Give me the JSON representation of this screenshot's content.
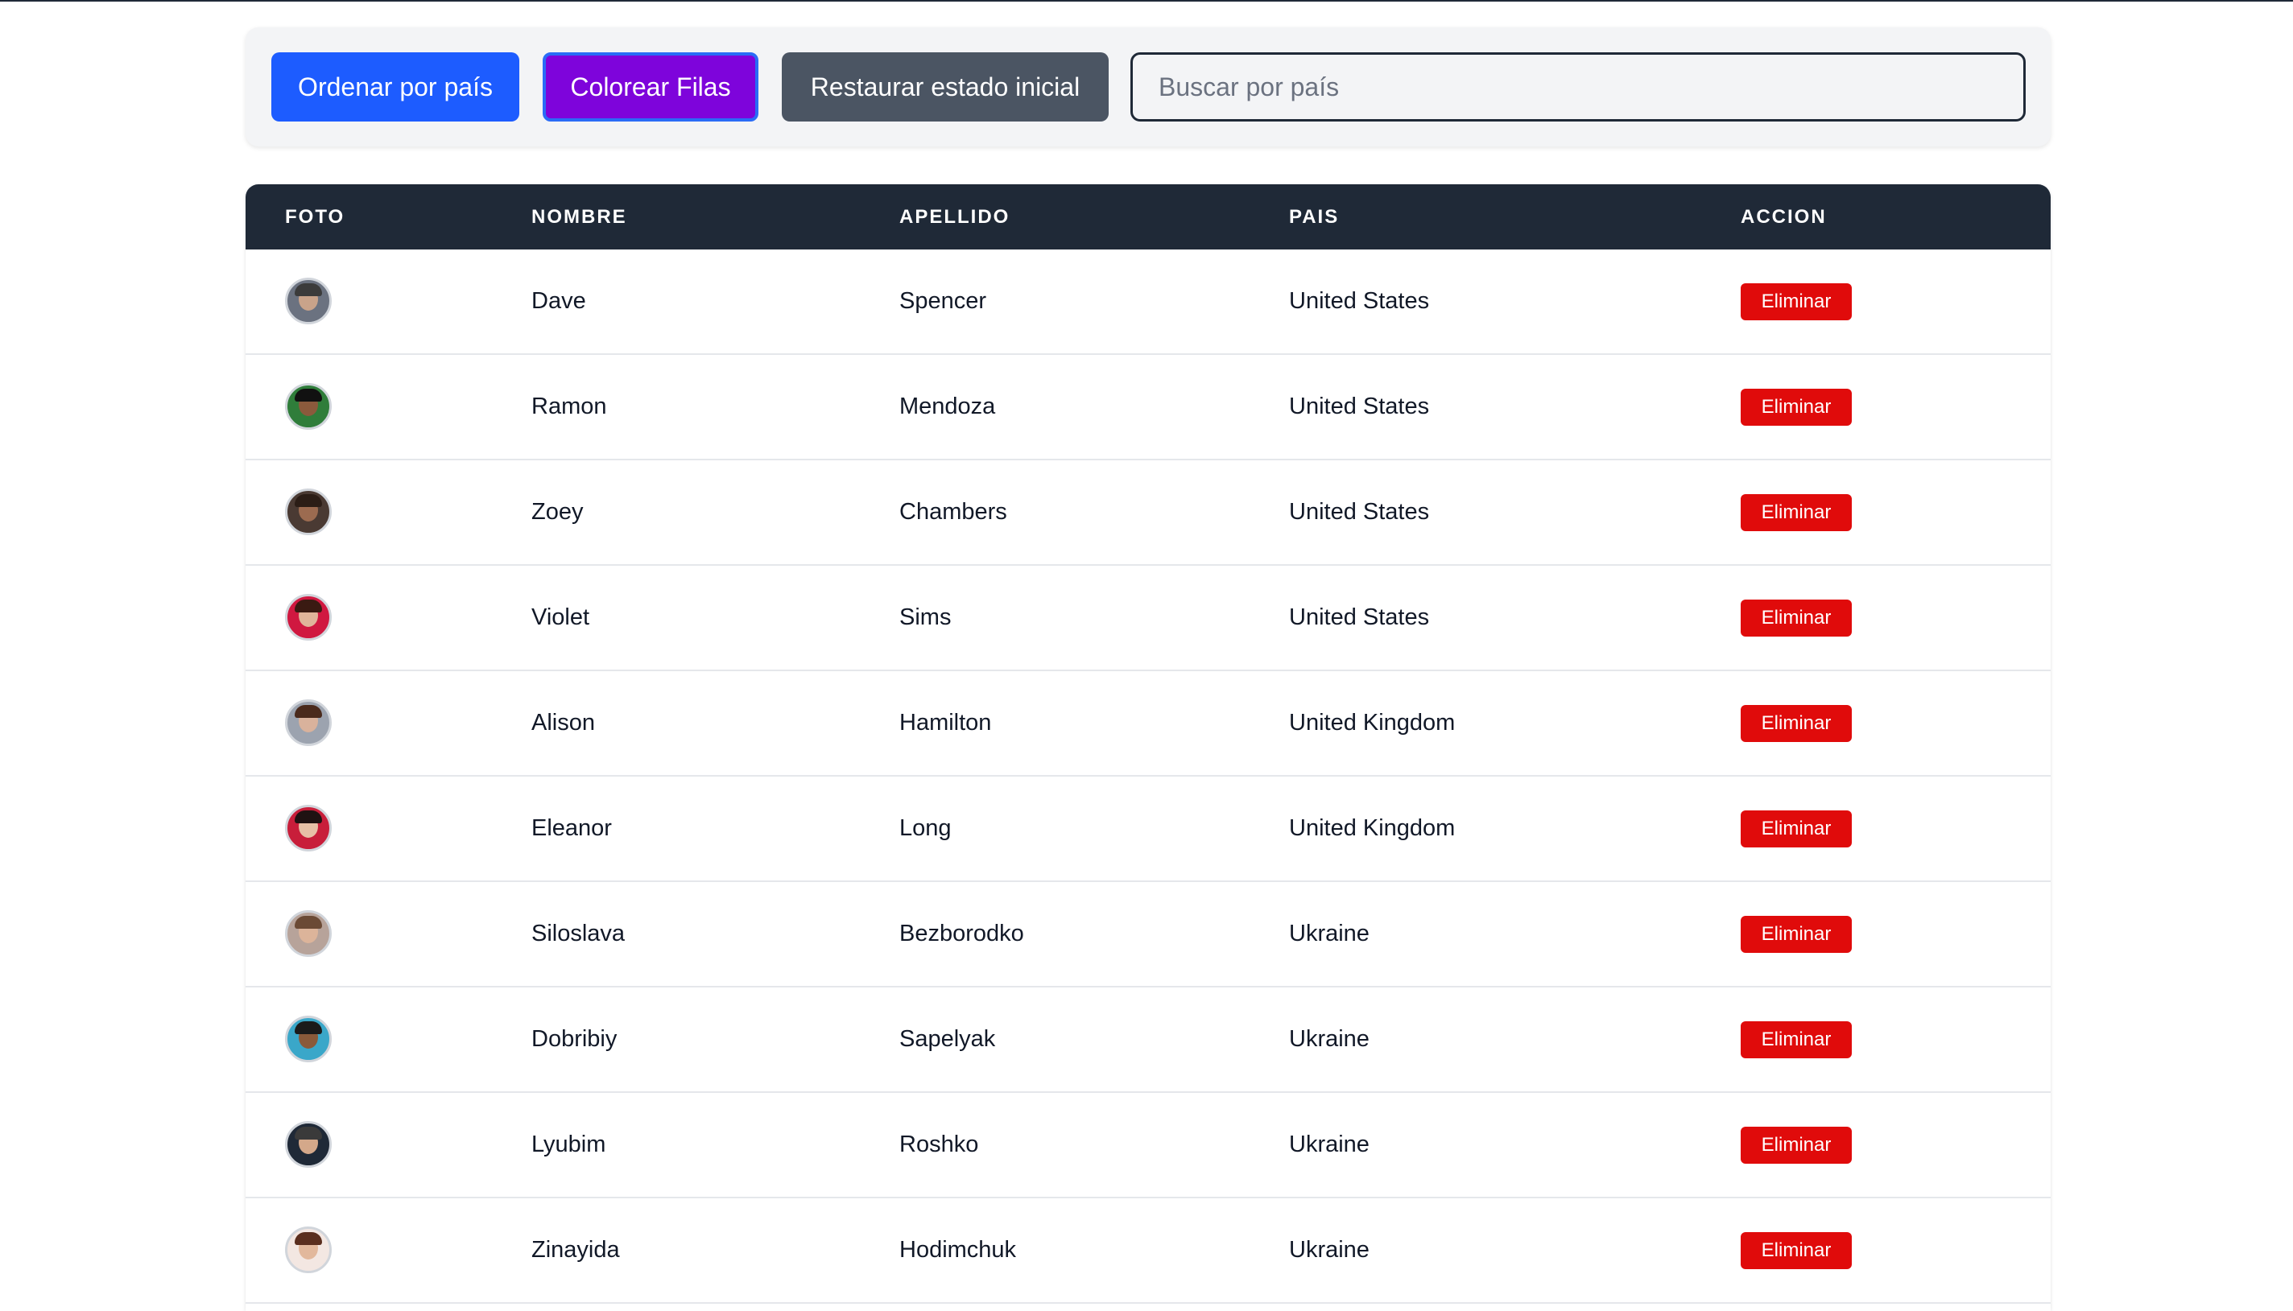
{
  "toolbar": {
    "sort_label": "Ordenar por país",
    "color_label": "Colorear Filas",
    "reset_label": "Restaurar estado inicial",
    "search_placeholder": "Buscar por país",
    "search_value": ""
  },
  "table": {
    "headers": [
      "FOTO",
      "NOMBRE",
      "APELLIDO",
      "PAIS",
      "ACCION"
    ],
    "delete_label": "Eliminar",
    "rows": [
      {
        "nombre": "Dave",
        "apellido": "Spencer",
        "pais": "United States",
        "avatar": "avatar-photo"
      },
      {
        "nombre": "Ramon",
        "apellido": "Mendoza",
        "pais": "United States",
        "avatar": "avatar-photo"
      },
      {
        "nombre": "Zoey",
        "apellido": "Chambers",
        "pais": "United States",
        "avatar": "avatar-photo"
      },
      {
        "nombre": "Violet",
        "apellido": "Sims",
        "pais": "United States",
        "avatar": "avatar-photo"
      },
      {
        "nombre": "Alison",
        "apellido": "Hamilton",
        "pais": "United Kingdom",
        "avatar": "avatar-photo"
      },
      {
        "nombre": "Eleanor",
        "apellido": "Long",
        "pais": "United Kingdom",
        "avatar": "avatar-photo"
      },
      {
        "nombre": "Siloslava",
        "apellido": "Bezborodko",
        "pais": "Ukraine",
        "avatar": "avatar-photo"
      },
      {
        "nombre": "Dobribiy",
        "apellido": "Sapelyak",
        "pais": "Ukraine",
        "avatar": "avatar-photo"
      },
      {
        "nombre": "Lyubim",
        "apellido": "Roshko",
        "pais": "Ukraine",
        "avatar": "avatar-photo"
      },
      {
        "nombre": "Zinayida",
        "apellido": "Hodimchuk",
        "pais": "Ukraine",
        "avatar": "avatar-photo"
      }
    ]
  },
  "colors": {
    "sort_button": "#1d5cff",
    "color_button": "#7e04db",
    "reset_button": "#4b5563",
    "header_bg": "#1f2937",
    "delete_button": "#e00b0b"
  }
}
